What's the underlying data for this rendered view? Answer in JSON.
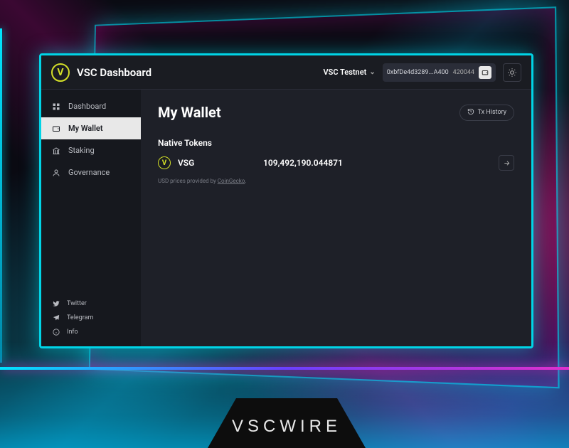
{
  "header": {
    "app_title": "VSC Dashboard",
    "network": "VSC Testnet",
    "address": "0xbfDe4d3289...A400",
    "balance_badge": "420044"
  },
  "sidebar": {
    "items": [
      {
        "label": "Dashboard",
        "icon": "grid-icon"
      },
      {
        "label": "My Wallet",
        "icon": "wallet-icon"
      },
      {
        "label": "Staking",
        "icon": "bank-icon"
      },
      {
        "label": "Governance",
        "icon": "user-icon"
      }
    ],
    "links": [
      {
        "label": "Twitter",
        "icon": "twitter-icon"
      },
      {
        "label": "Telegram",
        "icon": "telegram-icon"
      },
      {
        "label": "Info",
        "icon": "info-icon"
      }
    ]
  },
  "main": {
    "page_title": "My Wallet",
    "tx_history_label": "Tx History",
    "section_title": "Native Tokens",
    "token": {
      "symbol": "VSG",
      "amount": "109,492,190.044871"
    },
    "footnote_prefix": "USD prices provided by ",
    "footnote_link": "CoinGecko",
    "footnote_suffix": "."
  },
  "brand": {
    "text": "VSCWIRE"
  }
}
